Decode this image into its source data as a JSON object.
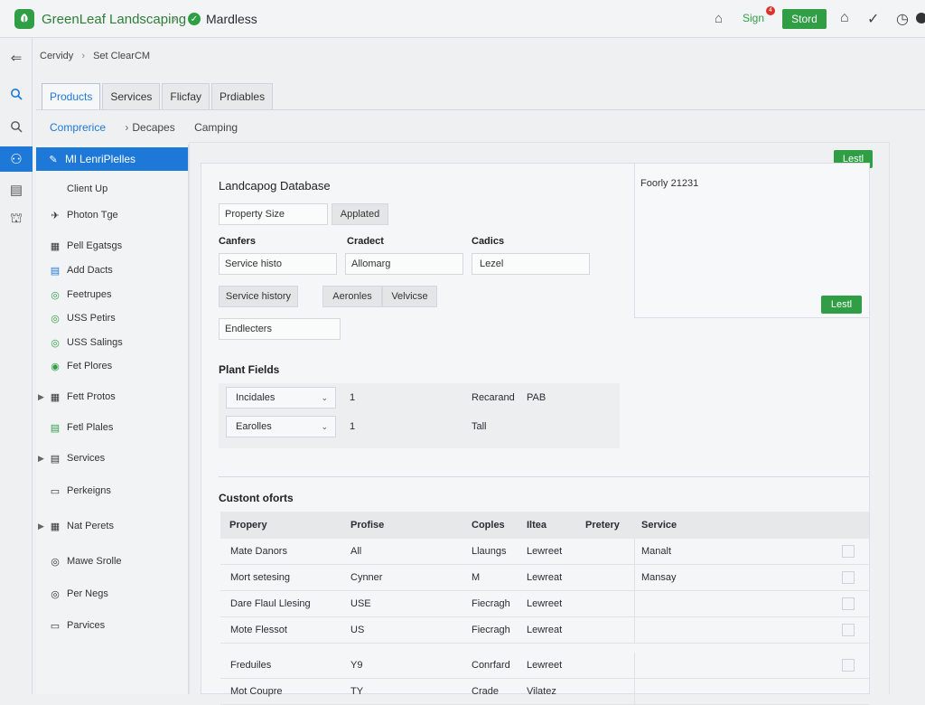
{
  "header": {
    "app_title": "GreenLeaf Landscaping",
    "project": "Mardless",
    "sign_label": "Sign",
    "notif_count": "4",
    "stord_label": "Stord"
  },
  "breadcrumb": {
    "first": "Cervidy",
    "second": "Set ClearCM"
  },
  "tabs": [
    "Products",
    "Services",
    "Flicfay",
    "Prdiables"
  ],
  "subtabs": [
    "Comprerice",
    "Decapes",
    "Camping"
  ],
  "sidebar": {
    "items": [
      {
        "label": "Ml LenriPlelles",
        "icon": "✎"
      },
      {
        "label": "Client Up",
        "icon": ""
      },
      {
        "label": "Photon Tge",
        "icon": "✈"
      },
      {
        "label": "Pell Egatsgs",
        "icon": "▦"
      },
      {
        "label": "Add Dacts",
        "icon": "▤"
      },
      {
        "label": "Feetrupes",
        "icon": "◎"
      },
      {
        "label": "USS Petirs",
        "icon": "◎"
      },
      {
        "label": "USS Salings",
        "icon": "◎"
      },
      {
        "label": "Fet Plores",
        "icon": "◉"
      },
      {
        "label": "Fett Protos",
        "icon": "▦"
      },
      {
        "label": "Fetl Plales",
        "icon": "▤"
      },
      {
        "label": "Services",
        "icon": "▤"
      },
      {
        "label": "Perkeigns",
        "icon": "▭"
      },
      {
        "label": "Nat Perets",
        "icon": "▦"
      },
      {
        "label": "Mawe Srolle",
        "icon": "◎"
      },
      {
        "label": "Per Negs",
        "icon": "◎"
      },
      {
        "label": "Parvices",
        "icon": "▭"
      }
    ]
  },
  "db": {
    "title": "Landcapog Database",
    "property_field": "Property Size",
    "applied_chip": "Applated",
    "col1_label": "Canfers",
    "col2_label": "Cradect",
    "col3_label": "Cadics",
    "field1": "Service histo",
    "field2": "Allomarg",
    "field3": "Lezel",
    "service_history_chip": "Service history",
    "chip_a": "Aeronles",
    "chip_b": "Velvicse",
    "endlecters_field": "Endlecters",
    "add_button_top": "Lestl",
    "add_button_bottom": "Lestl",
    "side_note": "Foorly 21231"
  },
  "plant": {
    "title": "Plant Fields",
    "rows": [
      {
        "select": "Incidales",
        "qty": "1",
        "name": "Recarand",
        "code": "PAB"
      },
      {
        "select": "Earolles",
        "qty": "1",
        "name": "Tall",
        "code": ""
      }
    ]
  },
  "table": {
    "title": "Custont oforts",
    "headers": [
      "Propery",
      "Profise",
      "Coples",
      "Iltea",
      "Pretery",
      "Service"
    ],
    "rows": [
      [
        "Mate Danors",
        "All",
        "Llaungs",
        "Lewreet",
        "",
        "Manalt"
      ],
      [
        "Mort setesing",
        "Cynner",
        "M",
        "Lewreat",
        "",
        "Mansay"
      ],
      [
        "Dare Flaul Llesing",
        "USE",
        "Fiecragh",
        "Lewreet",
        "",
        ""
      ],
      [
        "Mote Flessot",
        "US",
        "Fiecragh",
        "Lewreat",
        "",
        ""
      ],
      [
        "Freduiles",
        "Y9",
        "Conrfard",
        "Lewreet",
        "",
        ""
      ],
      [
        "Mot Coupre",
        "TY",
        "Crade",
        "Vilatez",
        "",
        ""
      ]
    ]
  }
}
